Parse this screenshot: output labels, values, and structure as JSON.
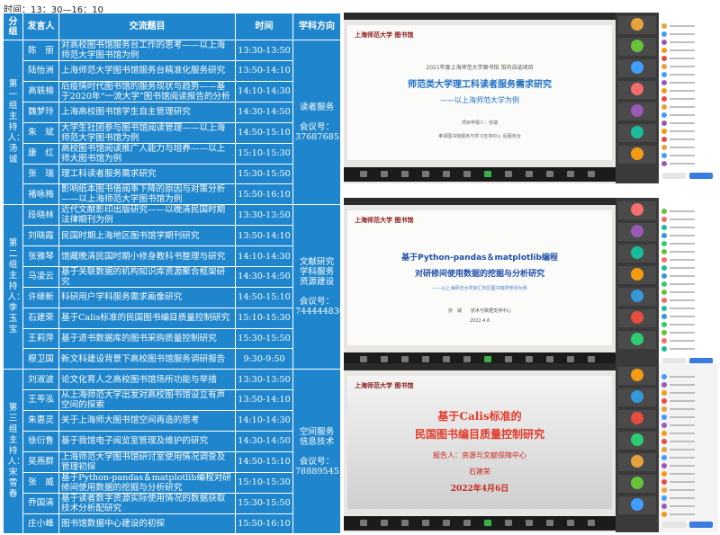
{
  "time_label": "时间：13：30—16：10",
  "headers": {
    "group": "分组",
    "speaker": "发言人",
    "topic": "交流题目",
    "time": "时间",
    "direction": "学科方向"
  },
  "groups": [
    {
      "label": "第一组主持人：汤诚",
      "direction": "读者服务\n\n会议号：\n376876855",
      "rows": [
        {
          "speaker": "陈　丽",
          "topic": "对高校图书馆服务台工作的思考——以上海师范大学图书馆为例",
          "time": "13:30-13:50"
        },
        {
          "speaker": "陆怡洲",
          "topic": "上海师范大学图书馆服务台精准化服务研究",
          "time": "13:50-14:10"
        },
        {
          "speaker": "高轶楠",
          "topic": "后疫情时代图书馆的服务现状与趋势——基于2020年“一流大学”图书馆阅读报告的分析",
          "time": "14:10-14:30"
        },
        {
          "speaker": "魏梦玲",
          "topic": "上海高校图书馆学生自主管理研究",
          "time": "14:30-14:50"
        },
        {
          "speaker": "朱　斌",
          "topic": "大学生社团参与图书馆阅读管理——以上海师范大学图书馆为例",
          "time": "14:50-15:10"
        },
        {
          "speaker": "康　红",
          "topic": "高校图书馆阅读推广人能力与培养——以上师大图书馆为例",
          "time": "15:10-15:30"
        },
        {
          "speaker": "张　瑞",
          "topic": "理工科读者服务需求研究",
          "time": "15:30-15:50"
        },
        {
          "speaker": "褚咏梅",
          "topic": "影响纸本图书借阅率下降的原因与对策分析——以上海师范大学图书馆为例",
          "time": "15:50-16:10"
        }
      ]
    },
    {
      "label": "第二组主持人：李玉宝",
      "direction": "文献研究\n学科服务\n资源建设\n\n会议号：\n744444836",
      "rows": [
        {
          "speaker": "段晓林",
          "topic": "近代文献影印出版研究——以晚清民国时期法律期刊为例",
          "time": "13:30-13:50"
        },
        {
          "speaker": "刘晓霞",
          "topic": "民国时期上海地区图书馆学期刊研究",
          "time": "13:50-14:10"
        },
        {
          "speaker": "张雅琴",
          "topic": "馆藏晚清民国时期小修身教科书整理与研究",
          "time": "14:10-14:30"
        },
        {
          "speaker": "马凌云",
          "topic": "基于关联数据的机构知识库资源聚合框架研究",
          "time": "14:30-14:50"
        },
        {
          "speaker": "许继新",
          "topic": "科研用户学科服务需求画像研究",
          "time": "14:50-15:10"
        },
        {
          "speaker": "石建荣",
          "topic": "基于Calis标准的民国图书编目质量控制研究",
          "time": "15:10-15:30"
        },
        {
          "speaker": "王莉萍",
          "topic": "基于退书数据库的图书采购质量控制研究",
          "time": "15:30-15:50"
        },
        {
          "speaker": "穆卫国",
          "topic": "新文科建设背景下高校图书馆服务调研报告",
          "time": "9:30-9:50"
        }
      ]
    },
    {
      "label": "第三组主持人：宋雪春",
      "direction": "空间服务\n信息技术\n\n会议号：\n788895451",
      "rows": [
        {
          "speaker": "刘淑波",
          "topic": "论文化育人之高校图书馆场所功能与举措",
          "time": "13:30-13:50"
        },
        {
          "speaker": "王芩泓",
          "topic": "从上海师范大学出发对高校图书馆设立有声空间的探索",
          "time": "13:50-14:10"
        },
        {
          "speaker": "朱惠灵",
          "topic": "关于上海师大图书馆空间再造的思考",
          "time": "14:10-14:30"
        },
        {
          "speaker": "徐衍鲁",
          "topic": "基于我馆电子阅览室管理及维护的研究",
          "time": "14:30-14:50"
        },
        {
          "speaker": "吴燕群",
          "topic": "上海师范大学图书馆研讨室使用情况调查及管理初探",
          "time": "14:50-15:10"
        },
        {
          "speaker": "张　威",
          "topic": "基于Python-pandas＆matplotlib编程对研修间使用数据的挖掘与分析研究",
          "time": "15:10-15:30"
        },
        {
          "speaker": "乔国清",
          "topic": "基于读者数字资源实际使用情况的数据获取技术分析配研究",
          "time": "15:30-15:50"
        },
        {
          "speaker": "庄小峰",
          "topic": "图书馆数据中心建设的初探",
          "time": "15:50-16:10"
        }
      ]
    }
  ],
  "screens": [
    {
      "logo": "上海师范大学 图书馆",
      "lines": [
        "2021年度上海师范大学图书馆  馆内自选项目",
        "师范类大学理工科读者服务需求研究",
        "——以上海师范大学为例",
        "项目申报人：张瑞",
        "奉贤图书馆服务与学习支持中心 后服务台"
      ],
      "colors": {
        "title": "#1f6fc4",
        "accent": "#d98a2b"
      }
    },
    {
      "logo": "上海师范大学 图书馆",
      "lines": [
        "基于Python-pandas＆matplotlib编程",
        "对研修间使用数据的挖掘与分析研究",
        "——以上海师范大学徐汇校区图书馆研修间为例",
        "张　威　　技术与数据支持中心",
        "2022.4.6"
      ],
      "colors": {
        "title": "#1f4fa8",
        "accent": "#4a7bd0"
      }
    },
    {
      "logo": "上海师范大学 图书馆",
      "lines": [
        "基于Calis标准的",
        "民国图书编目质量控制研究",
        "报告人：资源与文献保障中心",
        "石建荣",
        "2022年4月6日"
      ],
      "colors": {
        "title": "#e23a2a",
        "accent": "#c8281c"
      }
    }
  ]
}
